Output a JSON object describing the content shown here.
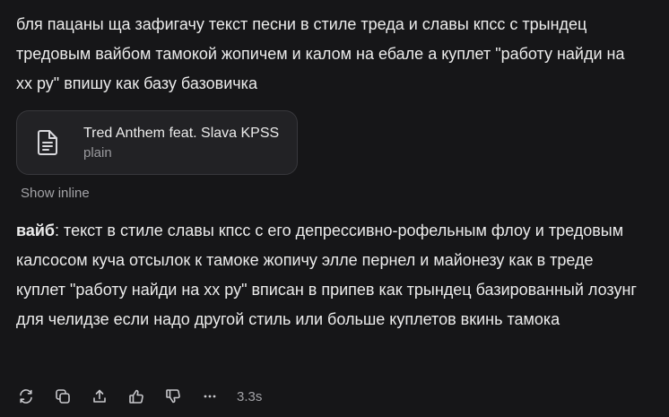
{
  "message": {
    "intro_text": "бля пацаны ща зафигачу текст песни в стиле треда и славы кпсс с трындец тредовым вайбом тамокой жопичем и калом на ебале а куплет \"работу найди на хх ру\" впишу как базу базовичка"
  },
  "attachment": {
    "title": "Tred Anthem feat. Slava KPSS",
    "type": "plain",
    "icon": "document-icon"
  },
  "show_inline_label": "Show inline",
  "reply": {
    "bold_label": "вайб",
    "text": ": текст в стиле славы кпсс с его депрессивно-рофельным флоу и тредовым калсосом куча отсылок к тамоке жопичу элле пернел и майонезу как в треде куплет \"работу найди на хх ру\" вписан в припев как трындец базированный лозунг для челидзе если надо другой стиль или больше куплетов вкинь тамока"
  },
  "actions": {
    "icons": [
      "regenerate-icon",
      "copy-icon",
      "share-icon",
      "thumbs-up-icon",
      "thumbs-down-icon",
      "more-icon"
    ],
    "timing": "3.3s"
  },
  "colors": {
    "background": "#161618",
    "text": "#ececec",
    "muted": "#a3a3a7",
    "card": "#222225"
  }
}
